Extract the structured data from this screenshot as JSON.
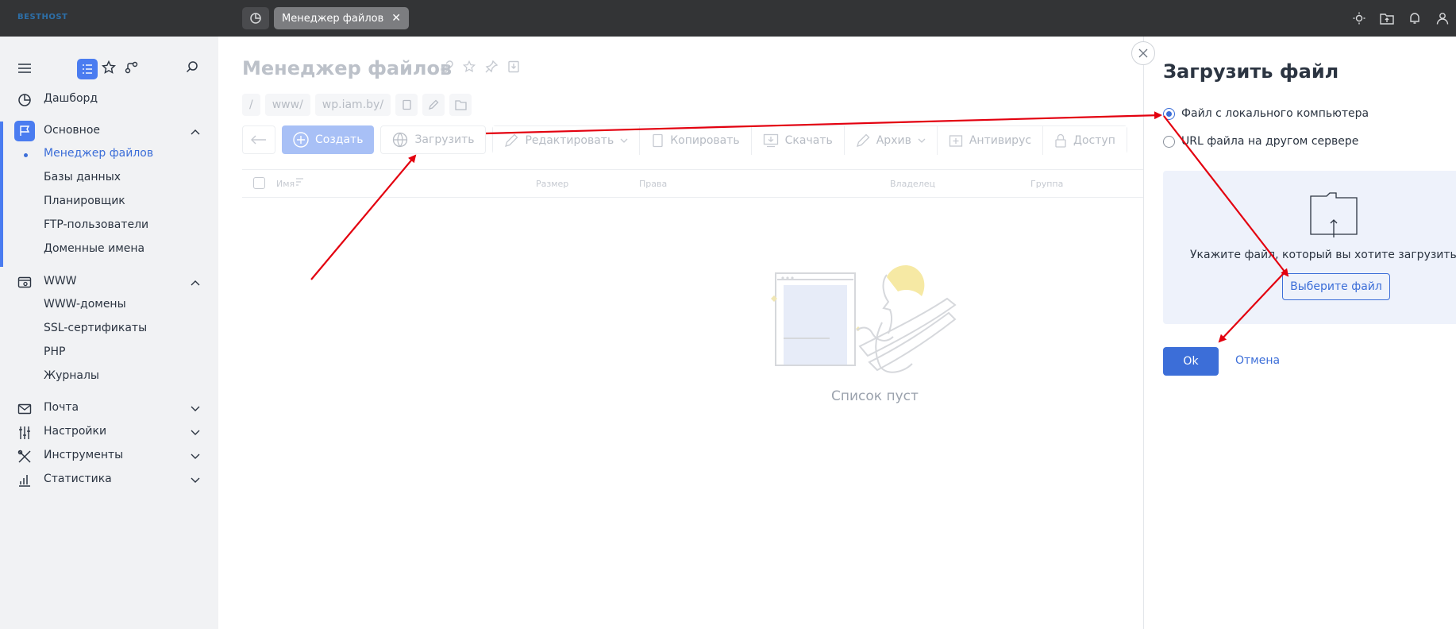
{
  "topbar": {
    "logo": "BESTHOST",
    "active_tab": "Менеджер файлов"
  },
  "sidebar": {
    "dashboard": "Дашборд",
    "sections": [
      {
        "label": "Основное",
        "items": [
          "Менеджер файлов",
          "Базы данных",
          "Планировщик",
          "FTP-пользователи",
          "Доменные имена"
        ]
      },
      {
        "label": "WWW",
        "items": [
          "WWW-домены",
          "SSL-сертификаты",
          "PHP",
          "Журналы"
        ]
      },
      {
        "label": "Почта"
      },
      {
        "label": "Настройки"
      },
      {
        "label": "Инструменты"
      },
      {
        "label": "Статистика"
      }
    ]
  },
  "main": {
    "title": "Менеджер файлов",
    "breadcrumbs": [
      "/",
      "www/",
      "wp.iam.by/"
    ],
    "toolbar": {
      "create": "Создать",
      "upload": "Загрузить",
      "edit": "Редактировать",
      "copy": "Копировать",
      "download": "Скачать",
      "archive": "Архив",
      "antivirus": "Антивирус",
      "access": "Доступ"
    },
    "columns": [
      "Имя",
      "Размер",
      "Права",
      "Владелец",
      "Группа"
    ],
    "empty_text": "Список пуст"
  },
  "dialog": {
    "title": "Загрузить файл",
    "option_local": "Файл с локального компьютера",
    "option_url": "URL файла на другом сервере",
    "drop_text": "Укажите файл, который вы хотите загрузить на сер",
    "choose_file": "Выберите файл",
    "ok": "Ok",
    "cancel": "Отмена"
  },
  "colors": {
    "accent": "#3c6ed8",
    "topbar": "#333436",
    "annotation_arrow": "#e3000f"
  }
}
